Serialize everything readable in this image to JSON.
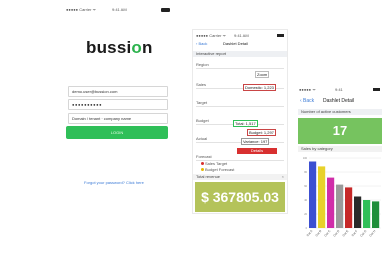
{
  "login": {
    "status_carrier": "●●●●● Carrier ᯤ",
    "status_time": "9:41 AM",
    "logo_text": "bussi",
    "logo_o": "o",
    "logo_end": "n",
    "username_value": "demo.user@bussion.com",
    "password_value": "●●●●●●●●●●",
    "remember_label": "Domain / tenant · company name",
    "login_button": "LOGIN",
    "forgot_link": "Forgot your password? Click here"
  },
  "report": {
    "status_carrier": "●●●●● Carrier ᯤ",
    "status_time": "9:41 AM",
    "back_label": "‹ Back",
    "title": "Dashlet Detail",
    "subtitle": "Interactive report",
    "rows": [
      {
        "k": "Region"
      },
      {
        "k": "Sales"
      },
      {
        "k": "Target"
      },
      {
        "k": "Budget"
      },
      {
        "k": "Actual"
      },
      {
        "k": "Forecast"
      }
    ],
    "tag_zoom": "Zoom",
    "tag_domestic": "Domestic: 1,223",
    "tag_custom": "Total: 1,517",
    "tag_budget": "Budget: 1,297",
    "tag_value": "Variance: 197",
    "red_bar": "Details",
    "legend1": "Sales   Target",
    "legend2": "Budget   Forecast",
    "money_header": "Total revenue",
    "money_close": "×",
    "money_value": "$ 367805.03",
    "legend_colors": {
      "a": "#d83030",
      "b": "#3c7bd6",
      "c": "#e6b800",
      "d": "#2fbf58"
    }
  },
  "detail": {
    "status_carrier": "●●●●● ᯤ",
    "status_time": "9:41",
    "back_label": "‹ Back",
    "title": "Dashlet Detail",
    "subtitle": "Number of active customers",
    "kpi_value": "17",
    "chart_header": "Sales by category"
  },
  "chart_data": {
    "type": "bar",
    "categories": [
      "Cat A",
      "Cat B",
      "Cat C",
      "Cat D",
      "Cat E",
      "Cat F",
      "Cat G",
      "Cat H"
    ],
    "values": [
      95,
      88,
      72,
      62,
      58,
      45,
      40,
      38
    ],
    "colors": [
      "#3c4fd1",
      "#e8d22a",
      "#d02ea9",
      "#9a9a9a",
      "#c62828",
      "#2a2a2a",
      "#2fbf58",
      "#1f8f3a"
    ],
    "ylim": [
      0,
      100
    ],
    "grid": true
  }
}
